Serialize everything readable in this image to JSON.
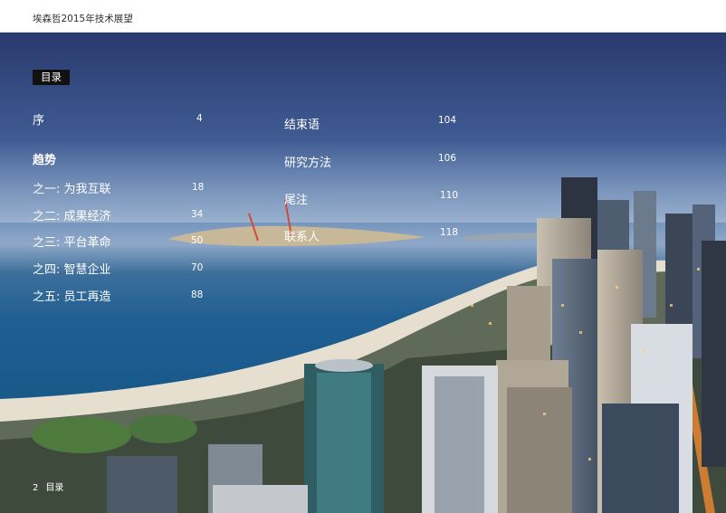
{
  "header": {
    "title": "埃森哲2015年技术展望"
  },
  "toc": {
    "badge": "目录",
    "left_column": [
      {
        "label": "序",
        "page": "4"
      },
      {
        "label": "趋势",
        "page": ""
      },
      {
        "label": "之一: 为我互联",
        "page": "18"
      },
      {
        "label": "之二: 成果经济",
        "page": "34"
      },
      {
        "label": "之三: 平台革命",
        "page": "50"
      },
      {
        "label": "之四: 智慧企业",
        "page": "70"
      },
      {
        "label": "之五: 员工再造",
        "page": "88"
      }
    ],
    "right_column": [
      {
        "label": "结束语",
        "page": "104"
      },
      {
        "label": "研究方法",
        "page": "106"
      },
      {
        "label": "尾注",
        "page": "110"
      },
      {
        "label": "联系人",
        "page": "118"
      }
    ]
  },
  "footer": {
    "page_number": "2",
    "section": "目录"
  },
  "colors": {
    "badge_bg": "#111111",
    "text": "#ffffff",
    "sky": "#3f5b92",
    "sea": "#1b5b8e"
  }
}
